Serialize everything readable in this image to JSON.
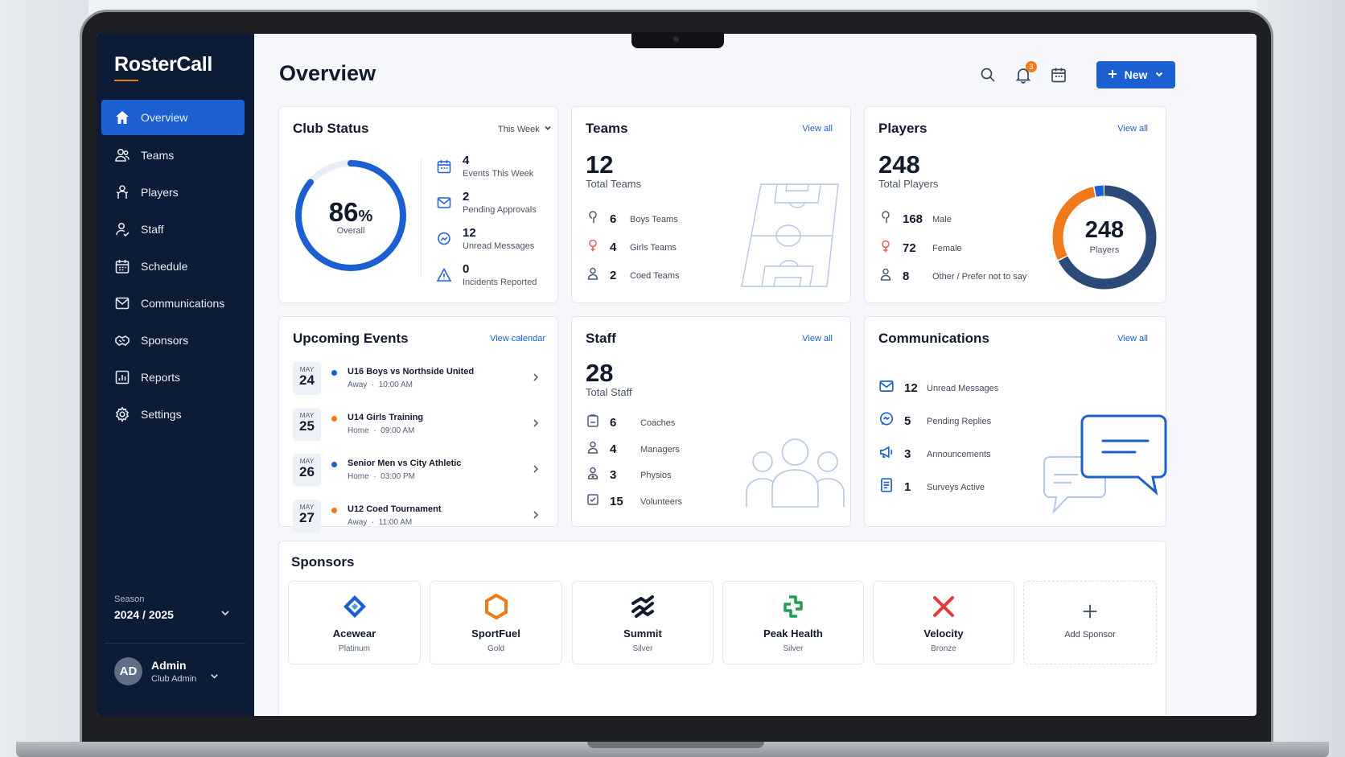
{
  "app": {
    "name": "RosterCall"
  },
  "page": {
    "title": "Overview"
  },
  "sidebar": {
    "items": [
      {
        "label": "Overview",
        "icon": "home-icon"
      },
      {
        "label": "Teams",
        "icon": "teams-icon"
      },
      {
        "label": "Players",
        "icon": "players-icon"
      },
      {
        "label": "Staff",
        "icon": "staff-icon"
      },
      {
        "label": "Schedule",
        "icon": "calendar-icon"
      },
      {
        "label": "Communications",
        "icon": "mail-icon"
      },
      {
        "label": "Sponsors",
        "icon": "handshake-icon"
      },
      {
        "label": "Reports",
        "icon": "reports-icon"
      },
      {
        "label": "Settings",
        "icon": "gear-icon"
      }
    ],
    "season_label": "Season",
    "season_value": "2024 / 2025",
    "user": {
      "initials": "AD",
      "name": "Admin",
      "role": "Club Admin"
    }
  },
  "header": {
    "notification_count": "3",
    "new_label": "New"
  },
  "club_status": {
    "title": "Club Status",
    "period": "This Week",
    "percent": "86",
    "percent_sign": "%",
    "percent_value": 86,
    "overall_label": "Overall",
    "stats": [
      {
        "value": "4",
        "label": "Events This Week",
        "icon": "calendar-icon"
      },
      {
        "value": "2",
        "label": "Pending Approvals",
        "icon": "mail-check-icon"
      },
      {
        "value": "12",
        "label": "Unread Messages",
        "icon": "chat-icon"
      },
      {
        "value": "0",
        "label": "Incidents Reported",
        "icon": "warning-icon"
      }
    ]
  },
  "teams": {
    "title": "Teams",
    "link": "View all",
    "total": "12",
    "total_label": "Total Teams",
    "rows": [
      {
        "value": "6",
        "label": "Boys Teams"
      },
      {
        "value": "4",
        "label": "Girls Teams"
      },
      {
        "value": "2",
        "label": "Coed Teams"
      }
    ]
  },
  "players": {
    "title": "Players",
    "link": "View all",
    "total": "248",
    "total_label": "Total Players",
    "donut_value": "248",
    "donut_label": "Players",
    "rows": [
      {
        "value": "168",
        "label": "Male"
      },
      {
        "value": "72",
        "label": "Female"
      },
      {
        "value": "8",
        "label": "Other / Prefer not to say"
      }
    ],
    "colors": {
      "male": "#2c4a77",
      "female": "#f07a1a",
      "other": "#1b5fd0"
    }
  },
  "events": {
    "title": "Upcoming Events",
    "link": "View calendar",
    "items": [
      {
        "month": "MAY",
        "day": "24",
        "title": "U16 Boys vs Northside United",
        "venue": "Away",
        "time": "10:00 AM",
        "color": "#1b5fd0"
      },
      {
        "month": "MAY",
        "day": "25",
        "title": "U14 Girls Training",
        "venue": "Home",
        "time": "09:00 AM",
        "color": "#f07a1a"
      },
      {
        "month": "MAY",
        "day": "26",
        "title": "Senior Men vs City Athletic",
        "venue": "Home",
        "time": "03:00 PM",
        "color": "#1b5fd0"
      },
      {
        "month": "MAY",
        "day": "27",
        "title": "U12 Coed Tournament",
        "venue": "Away",
        "time": "11:00 AM",
        "color": "#f07a1a"
      }
    ]
  },
  "staff": {
    "title": "Staff",
    "link": "View all",
    "total": "28",
    "total_label": "Total Staff",
    "rows": [
      {
        "value": "6",
        "label": "Coaches"
      },
      {
        "value": "4",
        "label": "Managers"
      },
      {
        "value": "3",
        "label": "Physios"
      },
      {
        "value": "15",
        "label": "Volunteers"
      }
    ]
  },
  "communications": {
    "title": "Communications",
    "link": "View all",
    "rows": [
      {
        "value": "12",
        "label": "Unread Messages"
      },
      {
        "value": "5",
        "label": "Pending Replies"
      },
      {
        "value": "3",
        "label": "Announcements"
      },
      {
        "value": "1",
        "label": "Surveys Active"
      }
    ]
  },
  "sponsors": {
    "title": "Sponsors",
    "items": [
      {
        "name": "Acewear",
        "tier": "Platinum"
      },
      {
        "name": "SportFuel",
        "tier": "Gold"
      },
      {
        "name": "Summit",
        "tier": "Silver"
      },
      {
        "name": "Peak Health",
        "tier": "Silver"
      },
      {
        "name": "Velocity",
        "tier": "Bronze"
      }
    ],
    "add_label": "Add Sponsor"
  }
}
